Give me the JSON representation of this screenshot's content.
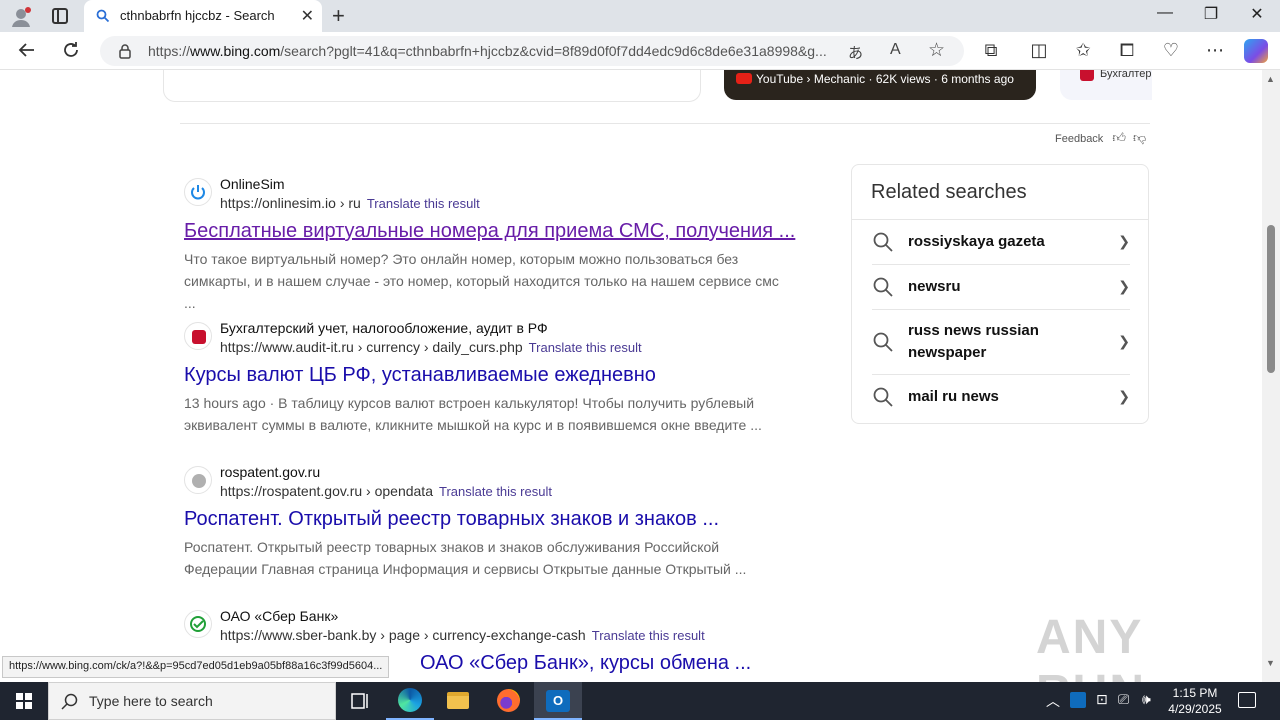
{
  "browser": {
    "tab_title": "cthnbabrfn hjccbz - Search",
    "new_tab_label": "+",
    "url_prefix": "https://",
    "url_host": "www.bing.com",
    "url_rest": "/search?pglt=41&q=cthnbabrfn+hjccbz&cvid=8f89d0f0f7dd4edc9d6c8de6e31a8998&g..."
  },
  "top": {
    "video_meta": "YouTube › Mechanic · 62K views · 6 months ago",
    "partial_card_text": "Бухгалтер"
  },
  "feedback_label": "Feedback",
  "results": [
    {
      "site_name": "OnlineSim",
      "url": "https://onlinesim.io › ru",
      "translate": "Translate this result",
      "title": "Бесплатные виртуальные номера для приема СМС, получения ...",
      "snippet": "Что такое виртуальный номер? Это онлайн номер, которым можно пользоваться без симкарты, и в нашем случае - это номер, который находится только на нашем сервисе смс ..."
    },
    {
      "site_name": "Бухгалтерский учет, налогообложение, аудит в РФ",
      "url": "https://www.audit-it.ru › currency › daily_curs.php",
      "translate": "Translate this result",
      "title": "Курсы валют ЦБ РФ, устанавливаемые ежедневно",
      "snippet": "13 hours ago · В таблицу курсов валют встроен калькулятор! Чтобы получить рублевый эквивалент суммы в валюте, кликните мышкой на курс и в появившемся окне введите ..."
    },
    {
      "site_name": "rospatent.gov.ru",
      "url": "https://rospatent.gov.ru › opendata",
      "translate": "Translate this result",
      "title": "Роспатент. Открытый реестр товарных знаков и знаков ...",
      "snippet": "Роспатент. Открытый реестр товарных знаков и знаков обслуживания Российской Федерации Главная страница Информация и сервисы Открытые данные Открытый ..."
    },
    {
      "site_name": "ОАО «Сбер Банк»",
      "url": "https://www.sber-bank.by › page › currency-exchange-cash",
      "translate": "Translate this result",
      "title": "ОАО «Сбер Банк», курсы обмена ..."
    }
  ],
  "related": {
    "title": "Related searches",
    "items": [
      "rossiyskaya gazeta",
      "newsru",
      "russ news russian newspaper",
      "mail ru news"
    ]
  },
  "status_url": "https://www.bing.com/ck/a?!&&p=95cd7ed05d1eb9a05bf88a16c3f99d5604...",
  "watermark": "ANY RUN",
  "taskbar": {
    "search_placeholder": "Type here to search",
    "time": "1:15 PM",
    "date": "4/29/2025"
  },
  "colors": {
    "link": "#1a0dab",
    "visited": "#681da8",
    "translate": "#4a3a94",
    "taskbar": "#1f2530"
  }
}
